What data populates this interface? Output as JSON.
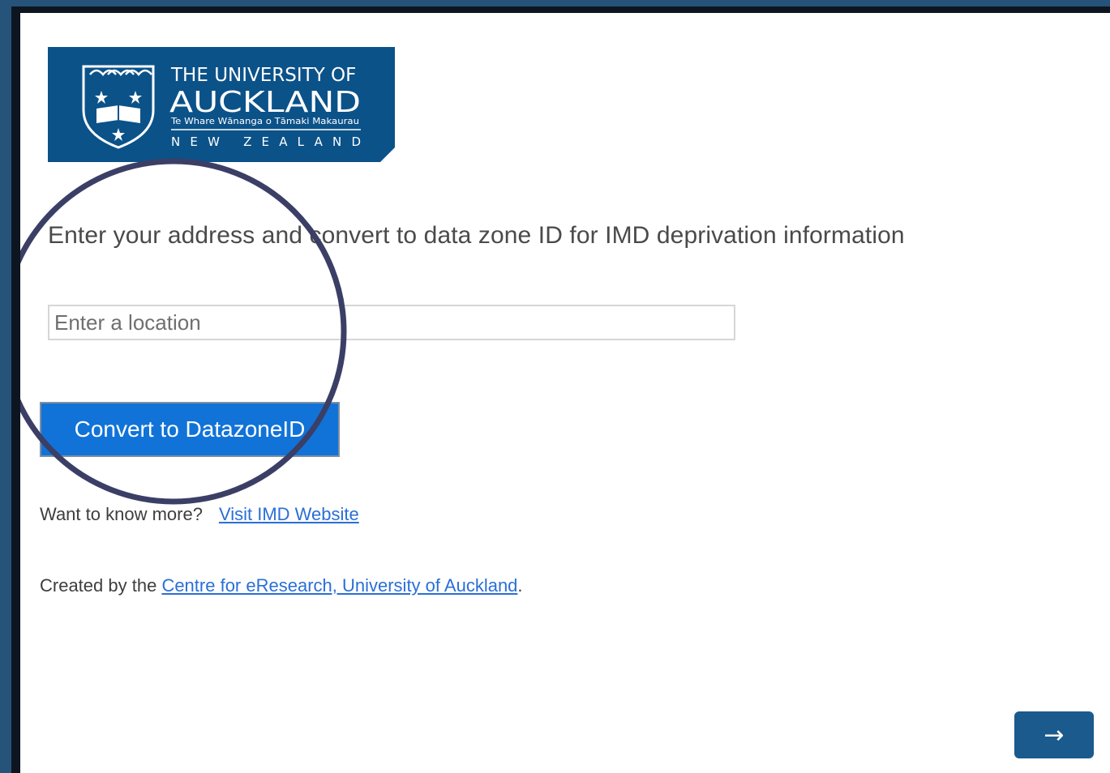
{
  "logo": {
    "line1": "THE UNIVERSITY OF",
    "line2": "AUCKLAND",
    "line3": "Te Whare Wānanga o Tāmaki Makaurau",
    "line4": "NEW ZEALAND",
    "color": "#0b5289"
  },
  "main": {
    "heading": "Enter your address and convert to data zone ID for IMD deprivation information",
    "location_placeholder": "Enter a location",
    "convert_label": "Convert to DatazoneID"
  },
  "links": {
    "want_more_text": "Want to know more?",
    "imd_link": "Visit IMD Website",
    "created_prefix": "Created by the ",
    "cer_link": "Centre for eResearch, University of Auckland",
    "created_suffix": "."
  },
  "navigation": {
    "next_icon": "right-arrow-icon",
    "next_glyph": "→"
  },
  "colors": {
    "accent": "#1173d8",
    "link": "#2a6fd6",
    "highlight_circle": "#3b3f66",
    "frame": "#26537a"
  }
}
